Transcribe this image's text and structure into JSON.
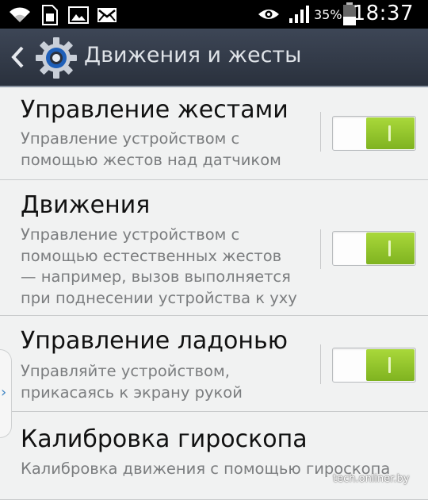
{
  "status_bar": {
    "battery_percent": "35%",
    "time": "18:37",
    "icons": [
      "wifi-icon",
      "sim-icon",
      "gallery-icon",
      "mail-icon",
      "eye-icon",
      "signal-icon",
      "battery-icon"
    ]
  },
  "action_bar": {
    "title": "Движения и жесты",
    "icons": [
      "back-chevron-icon",
      "settings-gear-icon"
    ]
  },
  "settings": [
    {
      "title": "Управление жестами",
      "desc": [
        "Управление устройством с",
        "помощью жестов над датчиком"
      ],
      "toggle": "on"
    },
    {
      "title": "Движения",
      "desc": [
        "Управление устройством с",
        "помощью естественных жестов",
        "— например, вызов выполняется",
        "при поднесении устройства к уху"
      ],
      "toggle": "on"
    },
    {
      "title": "Управление ладонью",
      "desc": [
        "Управляйте устройством,",
        "прикасаясь к экрану рукой"
      ],
      "toggle": "on"
    },
    {
      "title": "Калибровка гироскопа",
      "desc": [
        "Калибровка движения с помощью гироскопа"
      ]
    }
  ],
  "side_panel": {
    "icon": "chevron-right-icon",
    "glyph": "›"
  },
  "colors": {
    "accent": "#8cc22a",
    "actionbar": "#343c4a",
    "background": "#f1f2f2"
  },
  "watermark": "tech.onliner.by"
}
